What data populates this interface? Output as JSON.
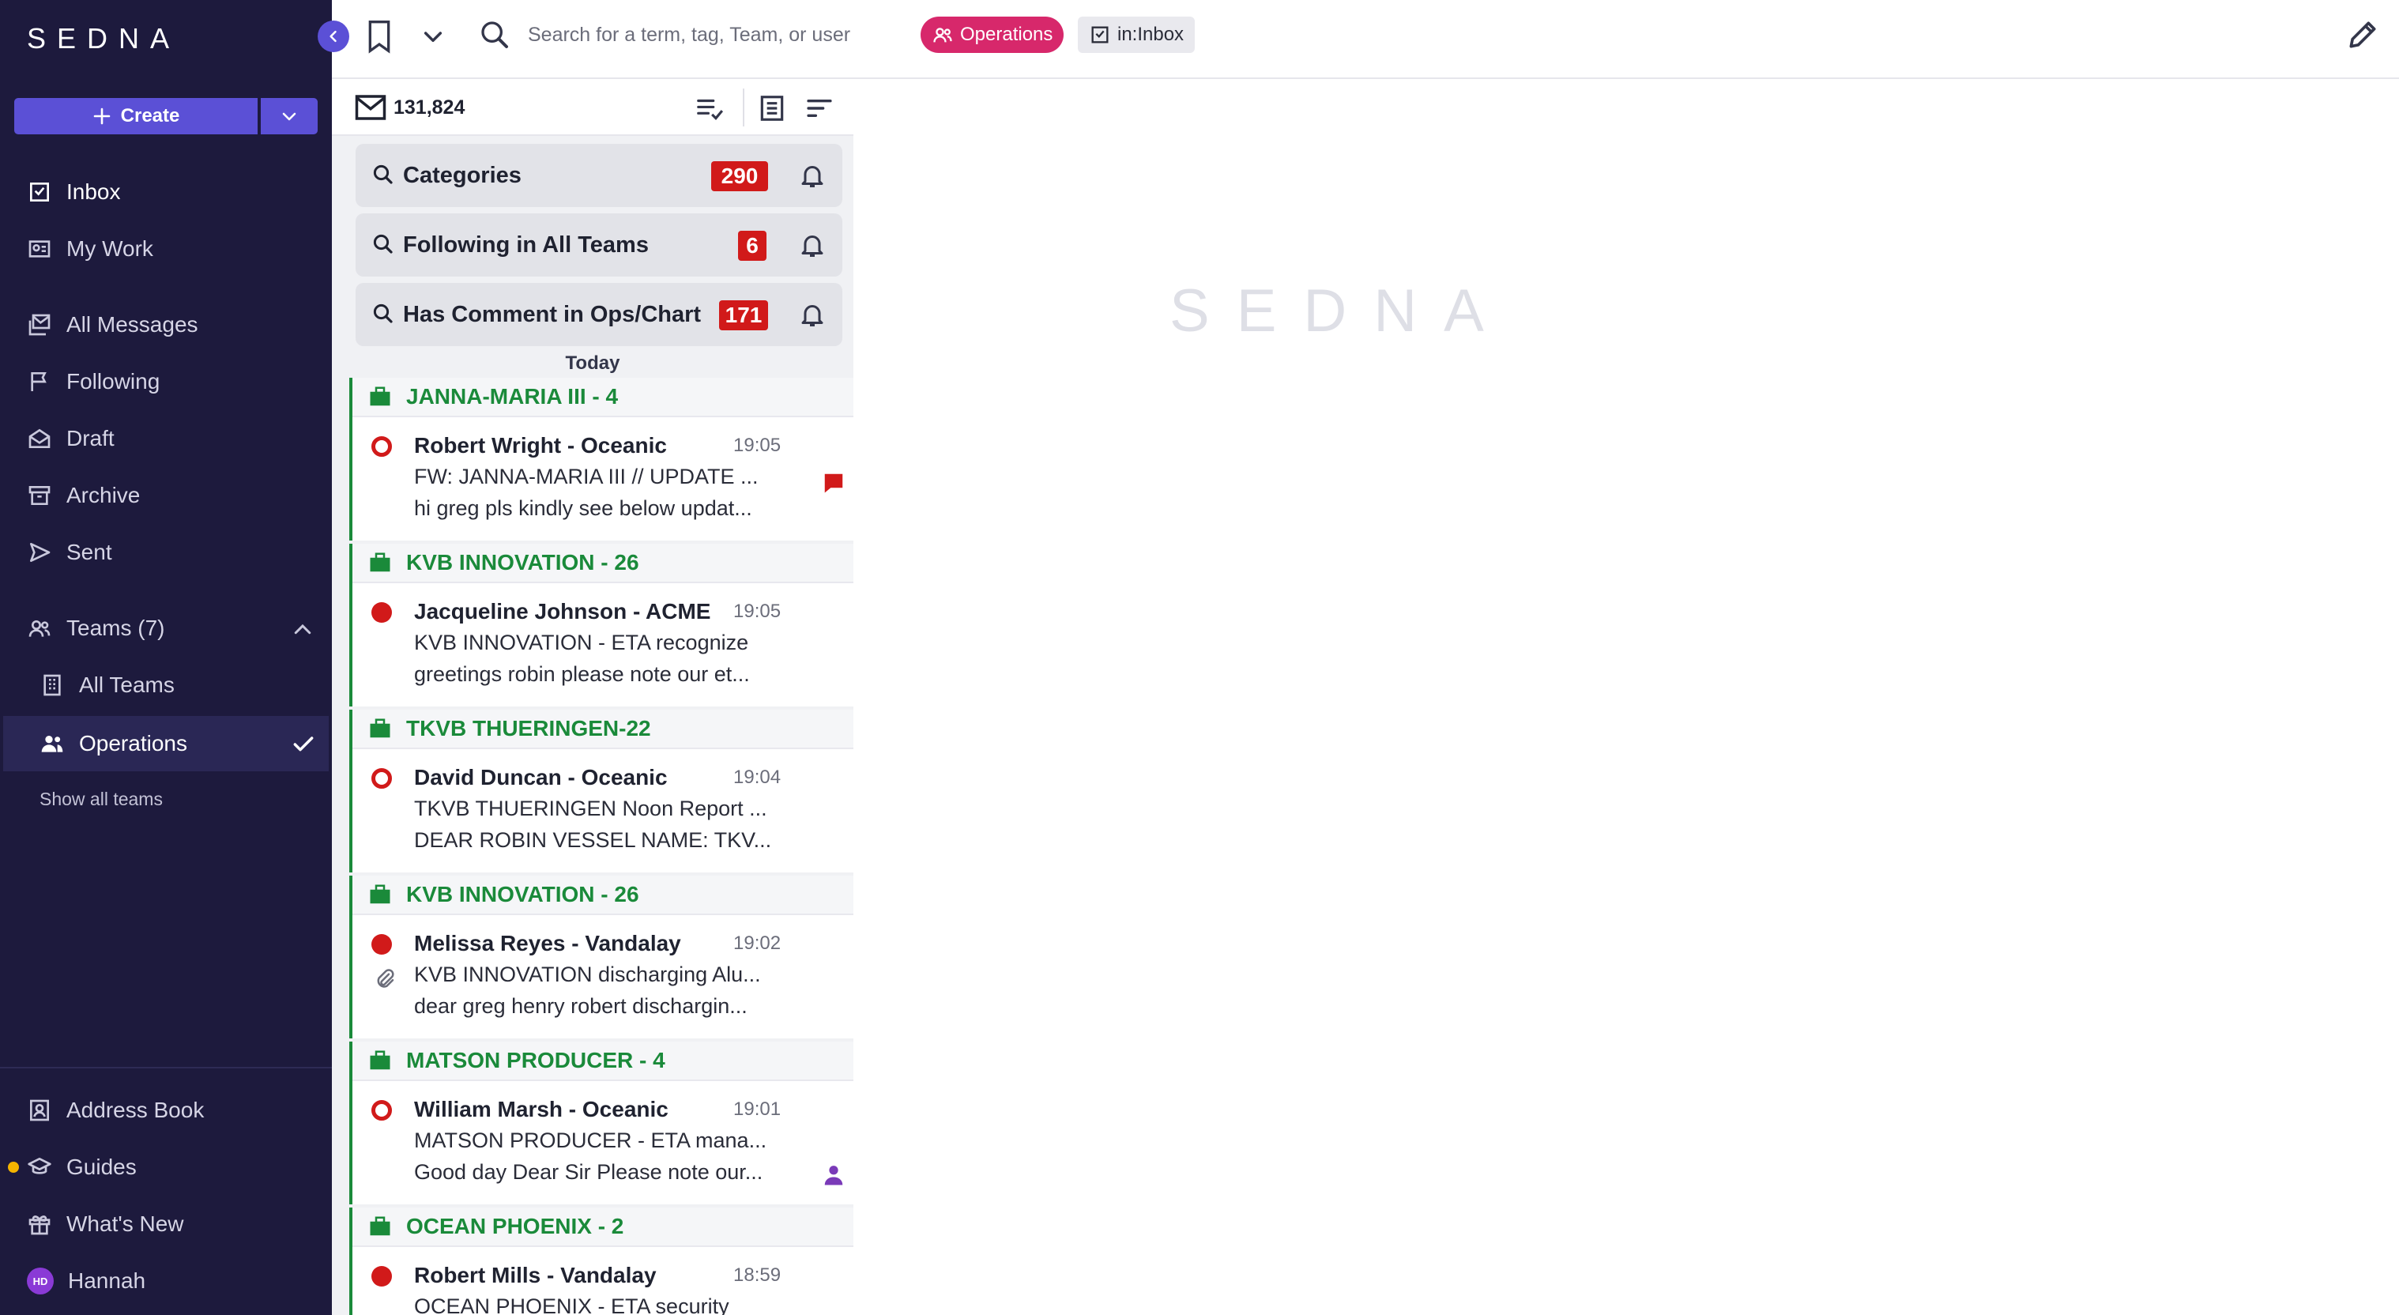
{
  "sidebar": {
    "logo": "SEDNA",
    "create_label": "Create",
    "nav": [
      {
        "label": "Inbox"
      },
      {
        "label": "My Work"
      },
      {
        "label": "All Messages"
      },
      {
        "label": "Following"
      },
      {
        "label": "Draft"
      },
      {
        "label": "Archive"
      },
      {
        "label": "Sent"
      }
    ],
    "teams_label": "Teams (7)",
    "teams": [
      {
        "label": "All Teams"
      },
      {
        "label": "Operations"
      }
    ],
    "show_all_teams": "Show all teams",
    "footer": [
      {
        "label": "Address Book"
      },
      {
        "label": "Guides"
      },
      {
        "label": "What's New"
      }
    ],
    "user": {
      "initials": "HD",
      "name": "Hannah"
    }
  },
  "topbar": {
    "search_placeholder": "Search for a term, tag, Team, or user",
    "chip_team": "Operations",
    "chip_inbox": "in:Inbox"
  },
  "list": {
    "count": "131,824",
    "saved_searches": [
      {
        "label": "Categories",
        "count": "290"
      },
      {
        "label": "Following in All Teams",
        "count": "6"
      },
      {
        "label": "Has Comment in Ops/Chart",
        "count": "171"
      }
    ],
    "date_header": "Today",
    "groups": [
      {
        "title": "JANNA-MARIA III - 4",
        "from": "Robert Wright - Oceanic",
        "time": "19:05",
        "subject": "FW: JANNA-MARIA III // UPDATE ...",
        "preview": "hi greg pls kindly see below updat..."
      },
      {
        "title": "KVB INNOVATION - 26",
        "from": "Jacqueline Johnson - ACME",
        "time": "19:05",
        "subject": "KVB INNOVATION - ETA recognize",
        "preview": "greetings robin please note our et..."
      },
      {
        "title": "TKVB THUERINGEN-22",
        "from": "David Duncan - Oceanic",
        "time": "19:04",
        "subject": "TKVB THUERINGEN Noon Report ...",
        "preview": "DEAR ROBIN VESSEL NAME: TKV..."
      },
      {
        "title": "KVB INNOVATION - 26",
        "from": "Melissa Reyes - Vandalay",
        "time": "19:02",
        "subject": "KVB INNOVATION discharging Alu...",
        "preview": "dear greg henry robert dischargin..."
      },
      {
        "title": "MATSON PRODUCER - 4",
        "from": "William Marsh - Oceanic",
        "time": "19:01",
        "subject": "MATSON PRODUCER - ETA mana...",
        "preview": "Good day Dear Sir Please note our..."
      },
      {
        "title": "OCEAN PHOENIX - 2",
        "from": "Robert Mills - Vandalay",
        "time": "18:59",
        "subject": "OCEAN PHOENIX - ETA security",
        "preview": ""
      }
    ]
  },
  "pane": {
    "watermark": "SEDNA"
  },
  "colors": {
    "sidebar_bg": "#1d1a3d",
    "accent": "#5b50d6",
    "team_chip": "#d7286b",
    "badge": "#d11a1a",
    "vessel_green": "#1a8a3a"
  }
}
